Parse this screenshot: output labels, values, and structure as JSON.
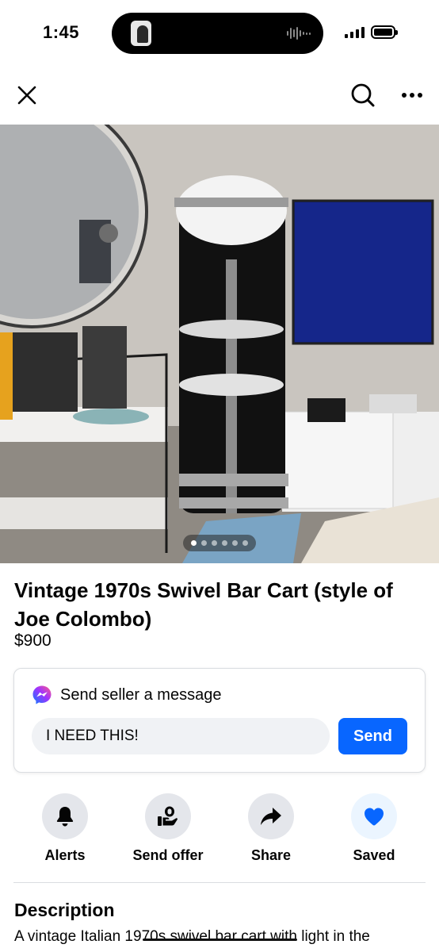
{
  "status_bar": {
    "time": "1:45",
    "icons": [
      "dynamic-island",
      "cellular-signal-icon",
      "battery-icon"
    ]
  },
  "nav": {
    "icons": [
      "close-icon",
      "search-icon",
      "more-icon"
    ]
  },
  "gallery": {
    "photo_count": 6,
    "active_index": 0
  },
  "listing": {
    "title": "Vintage 1970s Swivel Bar Cart (style of Joe Colombo)",
    "price": "$900"
  },
  "message": {
    "title": "Send seller a message",
    "input_value": "I NEED THIS!",
    "send_label": "Send",
    "icon": "messenger-icon"
  },
  "actions": [
    {
      "label": "Alerts",
      "icon": "bell-icon"
    },
    {
      "label": "Send offer",
      "icon": "offer-icon"
    },
    {
      "label": "Share",
      "icon": "share-icon"
    },
    {
      "label": "Saved",
      "icon": "heart-icon"
    }
  ],
  "description": {
    "heading": "Description",
    "text": "A vintage Italian 1970s swivel bar cart with light in the"
  },
  "colors": {
    "accent": "#0866ff",
    "icon_bg": "#e4e6eb",
    "saved_bg": "#ebf5ff"
  }
}
